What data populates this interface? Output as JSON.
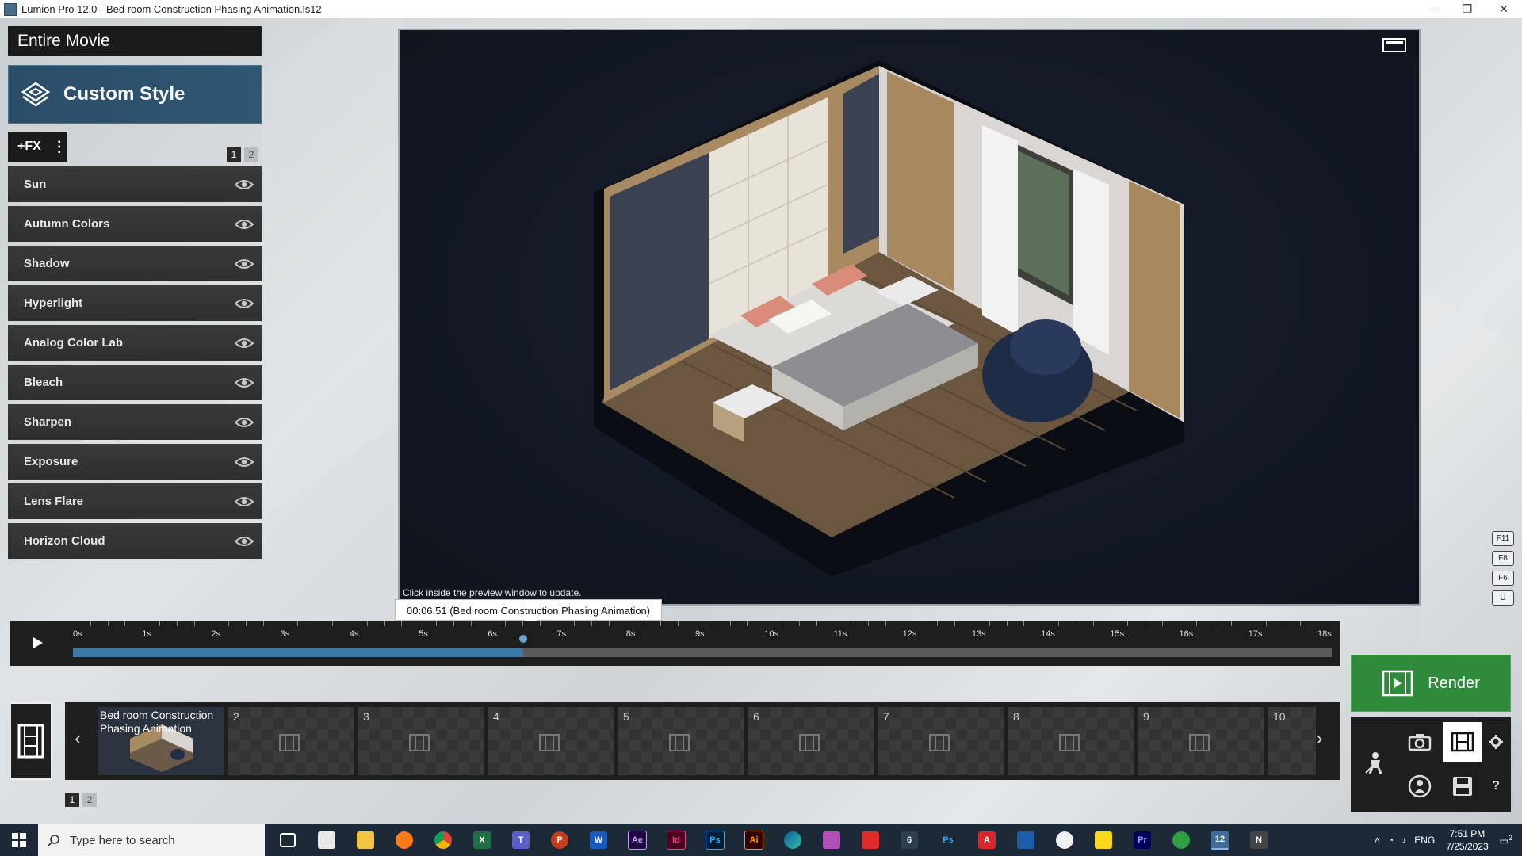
{
  "window": {
    "title": "Lumion Pro 12.0  - Bed room Construction Phasing Animation.ls12",
    "controls": [
      "–",
      "❐",
      "✕"
    ]
  },
  "left_panel": {
    "movie_title": "Entire Movie",
    "style_label": "Custom Style",
    "fx_label": "+FX",
    "fx_menu": "⋮",
    "pages": [
      "1",
      "2"
    ],
    "effects": [
      "Sun",
      "Autumn Colors",
      "Shadow",
      "Hyperlight",
      "Analog Color Lab",
      "Bleach",
      "Sharpen",
      "Exposure",
      "Lens Flare",
      "Horizon Cloud"
    ]
  },
  "preview": {
    "hint": "Click inside the preview window to update.",
    "fkeys": [
      "F11",
      "F8",
      "F6",
      "U"
    ]
  },
  "timeline": {
    "tooltip": "00:06.51 (Bed room Construction Phasing Animation)",
    "ticks": [
      "0s",
      "1s",
      "2s",
      "3s",
      "4s",
      "5s",
      "6s",
      "7s",
      "8s",
      "9s",
      "10s",
      "11s",
      "12s",
      "13s",
      "14s",
      "15s",
      "16s",
      "17s",
      "18s"
    ],
    "current_seconds": 6.51,
    "total_seconds": 18
  },
  "clips": {
    "first_title": "Bed room Construction Phasing Animation",
    "numbers": [
      "2",
      "3",
      "4",
      "5",
      "6",
      "7",
      "8",
      "9",
      "10"
    ],
    "pages": [
      "1",
      "2"
    ],
    "prev_arrow": "‹",
    "next_arrow": "›"
  },
  "render": {
    "label": "Render"
  },
  "taskbar": {
    "search_placeholder": "Type here to search",
    "apps": [
      "task-view",
      "app-grid",
      "file-explorer",
      "firefox",
      "chrome",
      "excel",
      "teams",
      "powerpoint",
      "word",
      "after-effects",
      "indesign",
      "photoshop",
      "illustrator",
      "edge",
      "teams-chat",
      "acrobat",
      "app-6",
      "ps-app",
      "autocad",
      "sketchup",
      "chrome-alt",
      "sticky-notes",
      "premiere",
      "clipchamp",
      "lumion",
      "app-n"
    ],
    "tray": {
      "lang": "ENG",
      "time": "7:51 PM",
      "date": "7/25/2023",
      "notif_count": "2"
    }
  },
  "colors": {
    "accent_blue": "#2f5673",
    "render_green": "#2f8a3b",
    "playhead": "#3d7aa7"
  }
}
